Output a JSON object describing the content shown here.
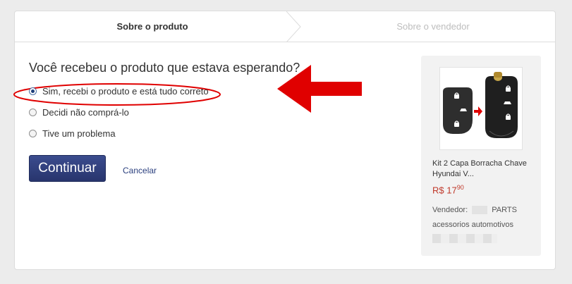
{
  "tabs": {
    "active_label": "Sobre o produto",
    "inactive_label": "Sobre o vendedor"
  },
  "form": {
    "question": "Você recebeu o produto que estava esperando?",
    "options": [
      {
        "label": "Sim, recebi o produto e está tudo correto",
        "checked": true
      },
      {
        "label": "Decidi não comprá-lo",
        "checked": false
      },
      {
        "label": "Tive um problema",
        "checked": false
      }
    ],
    "continue_label": "Continuar",
    "cancel_label": "Cancelar"
  },
  "product": {
    "title": "Kit 2 Capa Borracha Chave Hyundai V...",
    "price_currency": "R$",
    "price_int": "17",
    "price_cents": "90",
    "seller_label": "Vendedor:",
    "seller_name_suffix": "PARTS",
    "seller_line2": "acessorios automotivos"
  },
  "colors": {
    "accent": "#2a3f7e",
    "highlight": "#e00000",
    "price": "#c0392b"
  },
  "icons": {
    "arrow": "red-left-arrow-icon",
    "ellipse": "red-highlight-ellipse"
  }
}
